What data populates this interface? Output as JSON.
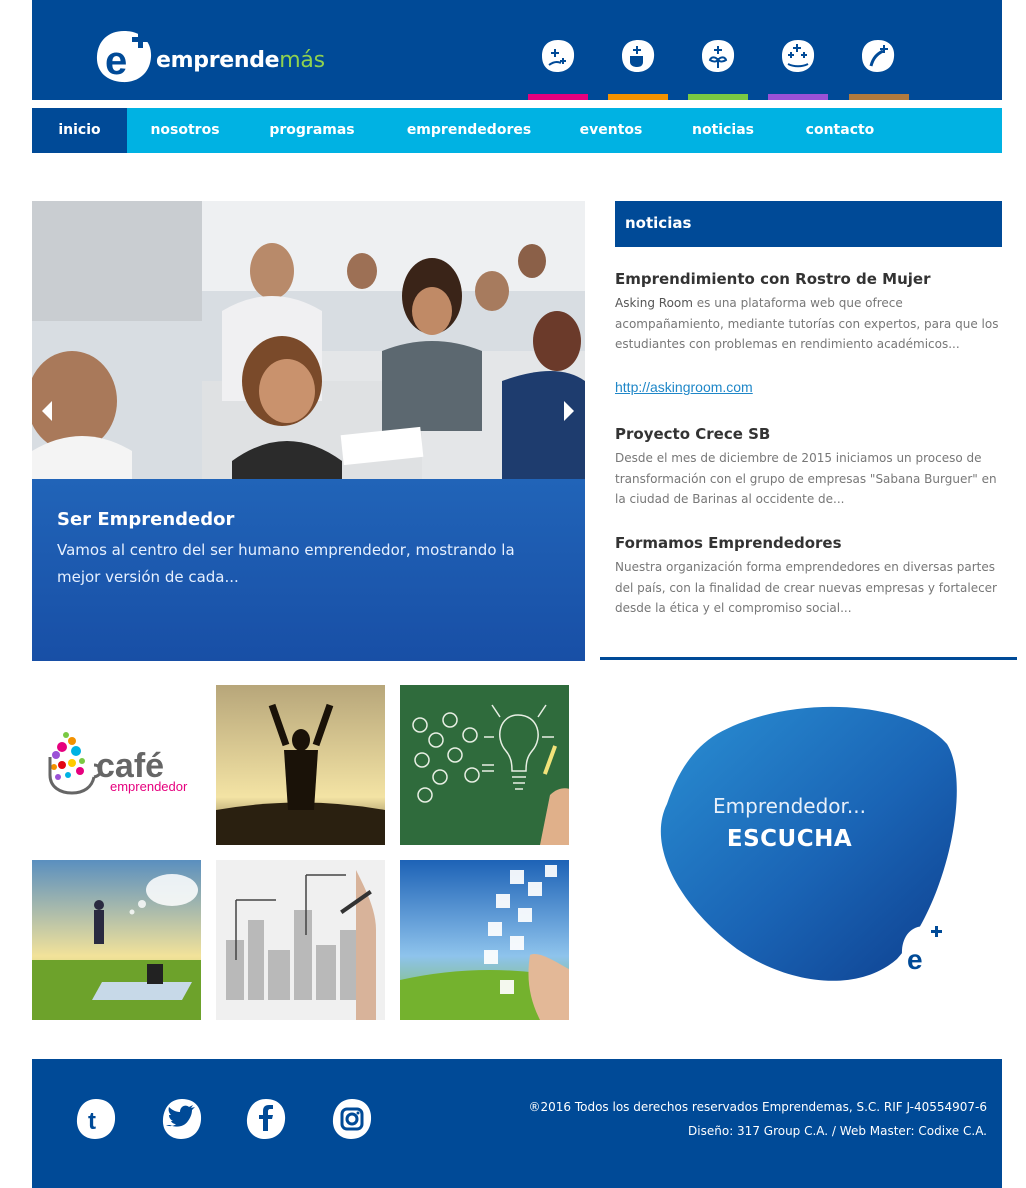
{
  "header": {
    "logo_text_bold": "emprende",
    "logo_text_accent": "más",
    "bar_colors": [
      "#e6007e",
      "#f39200",
      "#7ac943",
      "#9b51d6",
      "#b07a3e"
    ]
  },
  "nav": {
    "items": [
      {
        "label": "inicio"
      },
      {
        "label": "nosotros"
      },
      {
        "label": "programas"
      },
      {
        "label": "emprendedores"
      },
      {
        "label": "eventos"
      },
      {
        "label": "noticias"
      },
      {
        "label": "contacto"
      }
    ]
  },
  "slider": {
    "title": "Ser Emprendedor",
    "text": "Vamos al centro del ser humano emprendedor, mostrando la mejor versión de cada..."
  },
  "news": {
    "header": "noticias",
    "items": [
      {
        "title": "Emprendimiento con Rostro de Mujer",
        "lead": "Asking Room",
        "text": " es una plataforma web que ofrece acompañamiento, mediante tutorías con expertos, para que los estudiantes con problemas en rendimiento académicos..."
      },
      {
        "title": "Proyecto Crece SB",
        "text": "Desde el mes de diciembre de 2015 iniciamos un proceso de transformación con el grupo de empresas \"Sabana Burguer\" en la ciudad de Barinas al occidente de..."
      },
      {
        "title": "Formamos Emprendedores",
        "text": "Nuestra organización forma emprendedores en diversas partes del país, con la finalidad de crear nuevas empresas y fortalecer desde la ética y el compromiso social..."
      }
    ],
    "link": "http://askingroom.com"
  },
  "tiles": {
    "cafe_word": "café",
    "cafe_sub": "emprendedor"
  },
  "escucha": {
    "small": "Emprendedor...",
    "big": "ESCUCHA"
  },
  "footer": {
    "copyright": "®2016 Todos los derechos reservados Emprendemas, S.C. RIF J-40554907-6",
    "credits": "Diseño: 317 Group C.A. / Web Master: Codixe C.A.",
    "social": [
      "tumblr-icon",
      "twitter-icon",
      "facebook-icon",
      "instagram-icon"
    ]
  },
  "colors": {
    "primary": "#004a97",
    "nav": "#00b2e3",
    "accent_green": "#8fd14f"
  }
}
